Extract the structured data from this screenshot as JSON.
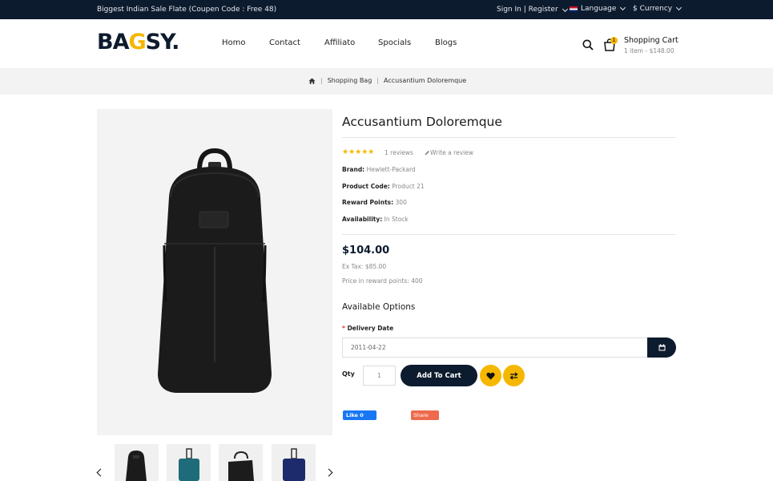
{
  "topbar": {
    "promo": "Biggest Indian Sale Flate (Coupen Code : Free 48)",
    "signin": "Sign In | Register",
    "language": "Language",
    "currency": "$ Currency"
  },
  "header": {
    "logo_parts": [
      "BA",
      "G",
      "SY."
    ],
    "nav": [
      "Homo",
      "Contact",
      "Affiliato",
      "Spocials",
      "Blogs"
    ],
    "cart_count": "1",
    "cart_title": "Shopping Cart",
    "cart_summary": "1 item - $148.00"
  },
  "breadcrumb": {
    "items": [
      "Shopping Bag",
      "Accusantium Doloremque"
    ]
  },
  "product": {
    "title": "Accusantium Doloremque",
    "rating": 5,
    "stars": "★★★★★",
    "reviews": "1 reviews",
    "write_review": "Write a review",
    "details": [
      {
        "label": "Brand:",
        "value": "Hewlett-Packard"
      },
      {
        "label": "Product Code:",
        "value": "Product 21"
      },
      {
        "label": "Reward Points:",
        "value": "300"
      },
      {
        "label": "Availability:",
        "value": "In Stock"
      }
    ],
    "price": "$104.00",
    "ex_tax": "Ex Tax: $85.00",
    "reward_price": "Price in reward points: 400"
  },
  "options": {
    "heading": "Available Options",
    "delivery_required": "*",
    "delivery_label": "Delivery Date",
    "delivery_value": "2011-04-22",
    "qty_label": "Qty",
    "qty_value": "1",
    "add_to_cart": "Add To Cart"
  },
  "social": {
    "like": "Like 0",
    "share": "Share"
  },
  "colors": {
    "navy": "#0d1b2e",
    "accent": "#f5b700"
  },
  "icons": [
    "search-icon",
    "bag-icon",
    "home-icon",
    "pencil-icon",
    "calendar-icon",
    "heart-icon",
    "compare-icon",
    "chevron-left-icon",
    "chevron-right-icon"
  ]
}
